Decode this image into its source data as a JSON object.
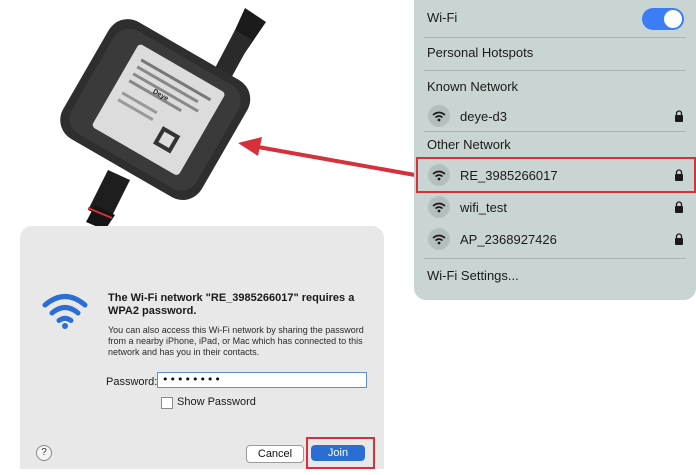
{
  "device": {
    "brand": "Deye"
  },
  "wifi_menu": {
    "title": "Wi-Fi",
    "toggle_on": true,
    "personal_hotspots": "Personal Hotspots",
    "known_header": "Known Network",
    "known_networks": [
      {
        "name": "deye-d3",
        "locked": true
      }
    ],
    "other_header": "Other Network",
    "other_networks": [
      {
        "name": "RE_3985266017",
        "locked": true,
        "highlighted": true
      },
      {
        "name": "wifi_test",
        "locked": true
      },
      {
        "name": "AP_2368927426",
        "locked": true
      }
    ],
    "settings": "Wi-Fi Settings..."
  },
  "dialog": {
    "title": "The Wi-Fi network \"RE_3985266017\" requires a WPA2 password.",
    "message": "You can also access this Wi-Fi network by sharing the password from a nearby iPhone, iPad, or Mac which has connected to this network and has you in their contacts.",
    "password_label": "Password:",
    "password_value": "••••••••",
    "show_password": "Show Password",
    "help": "?",
    "cancel": "Cancel",
    "join": "Join"
  },
  "colors": {
    "accent": "#2a6ed3",
    "highlight": "#d6303b",
    "panel_bg": "#c9d5d2",
    "toggle": "#3a7df5"
  }
}
